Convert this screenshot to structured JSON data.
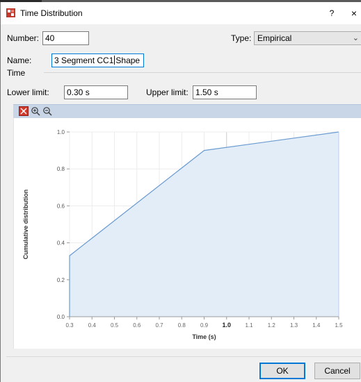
{
  "window": {
    "title": "Time Distribution",
    "help_label": "?",
    "close_label": "×"
  },
  "form": {
    "number_label": "Number:",
    "number_value": "40",
    "type_label": "Type:",
    "type_value": "Empirical",
    "name_label": "Name:",
    "name_value_before_caret": "3 Segment CC1",
    "name_value_after_caret": "Shape",
    "time_group_label": "Time",
    "lower_limit_label": "Lower limit:",
    "lower_limit_value": "0.30 s",
    "upper_limit_label": "Upper limit:",
    "upper_limit_value": "1.50 s"
  },
  "toolbar": {
    "icons": [
      "fit-view-icon",
      "zoom-in-icon",
      "zoom-out-icon"
    ]
  },
  "chart_data": {
    "type": "area",
    "xlabel": "Time (s)",
    "ylabel": "Cumulative distribution",
    "xlim": [
      0.3,
      1.5
    ],
    "ylim": [
      0.0,
      1.0
    ],
    "x_ticks": [
      "0.3",
      "0.4",
      "0.5",
      "0.6",
      "0.7",
      "0.8",
      "0.9",
      "1.0",
      "1.1",
      "1.2",
      "1.3",
      "1.4",
      "1.5"
    ],
    "y_ticks": [
      "0.0",
      "0.2",
      "0.4",
      "0.6",
      "0.8",
      "1.0"
    ],
    "bold_x_tick": "1.0",
    "points": [
      {
        "x": 0.3,
        "y": 0.0
      },
      {
        "x": 0.3,
        "y": 0.33
      },
      {
        "x": 0.9,
        "y": 0.9
      },
      {
        "x": 1.5,
        "y": 1.0
      }
    ],
    "grid": true,
    "line_color": "#6a9bd0",
    "fill_color": "#e3edf8"
  },
  "buttons": {
    "ok_label": "OK",
    "cancel_label": "Cancel"
  }
}
